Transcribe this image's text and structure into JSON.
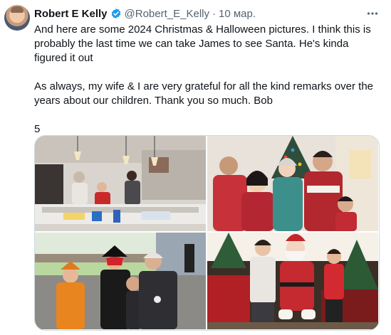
{
  "tweet": {
    "author_name": "Robert E Kelly",
    "handle": "@Robert_E_Kelly",
    "separator": "·",
    "date": "10 мар.",
    "text_lines": [
      "And here are some 2024 Christmas & Halloween pictures. I think this is probably the last time we can take James to see Santa. He's kinda figured it out",
      "As always, my wife & I are very grateful for all the kind remarks over the years about our children. Thank you so much. Bob",
      "5"
    ]
  },
  "icons": {
    "verified": "verified-badge-icon",
    "more": "more-options-icon"
  },
  "colors": {
    "text": "#0f1419",
    "muted": "#536471",
    "verified_blue": "#1d9bf0",
    "border": "#cfd9de"
  },
  "media": {
    "photos": [
      "kitchen-photo",
      "family-christmas-photo",
      "halloween-photo",
      "santa-photo"
    ]
  }
}
